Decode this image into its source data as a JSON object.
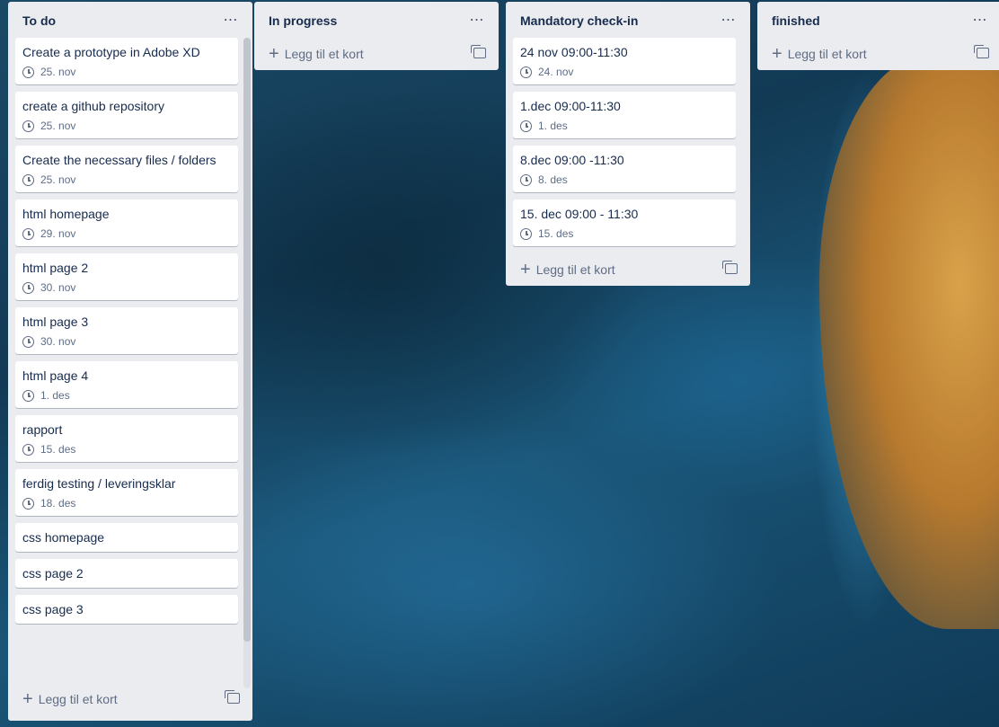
{
  "add_card_label": "Legg til et kort",
  "lists": [
    {
      "title": "To do",
      "cards": [
        {
          "title": "Create a prototype in Adobe XD",
          "date": "25. nov"
        },
        {
          "title": "create a github repository",
          "date": "25. nov"
        },
        {
          "title": "Create the necessary files / folders",
          "date": "25. nov"
        },
        {
          "title": "html homepage",
          "date": "29. nov"
        },
        {
          "title": "html page 2",
          "date": "30. nov"
        },
        {
          "title": "html page 3",
          "date": "30. nov"
        },
        {
          "title": "html page 4",
          "date": "1. des"
        },
        {
          "title": "rapport",
          "date": "15. des"
        },
        {
          "title": "ferdig testing / leveringsklar",
          "date": "18. des"
        },
        {
          "title": "css homepage"
        },
        {
          "title": "css page 2"
        },
        {
          "title": "css page 3"
        }
      ]
    },
    {
      "title": "In progress",
      "cards": []
    },
    {
      "title": "Mandatory check-in",
      "cards": [
        {
          "title": "24 nov 09:00-11:30",
          "date": "24. nov"
        },
        {
          "title": "1.dec 09:00-11:30",
          "date": "1. des"
        },
        {
          "title": "8.dec 09:00 -11:30",
          "date": "8. des"
        },
        {
          "title": "15. dec 09:00 - 11:30",
          "date": "15. des"
        }
      ]
    },
    {
      "title": "finished",
      "cards": []
    }
  ]
}
